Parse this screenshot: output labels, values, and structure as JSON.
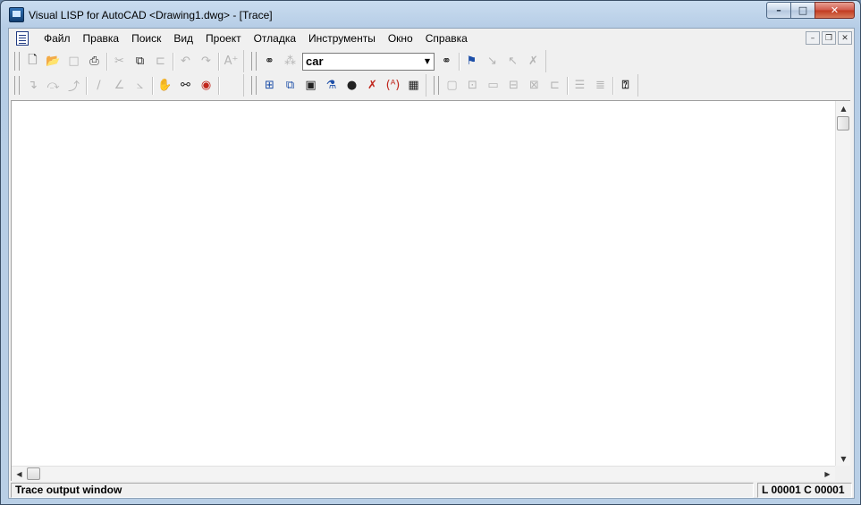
{
  "window": {
    "title": "Visual LISP for AutoCAD <Drawing1.dwg> - [Trace]",
    "minimize": "–",
    "maximize": "□",
    "close": "✕"
  },
  "menubar": {
    "items": [
      "Файл",
      "Правка",
      "Поиск",
      "Вид",
      "Проект",
      "Отладка",
      "Инструменты",
      "Окно",
      "Справка"
    ],
    "mdi_minimize": "–",
    "mdi_restore": "❐",
    "mdi_close": "✕"
  },
  "toolbar": {
    "search_combo_value": "car",
    "search_combo_arrow": "▼"
  },
  "content": {
    "text": ""
  },
  "statusbar": {
    "message": "Trace output window",
    "position": "L 00001  C 00001"
  },
  "scrollbars": {
    "up": "▲",
    "down": "▼",
    "left": "◀",
    "right": "▶"
  }
}
